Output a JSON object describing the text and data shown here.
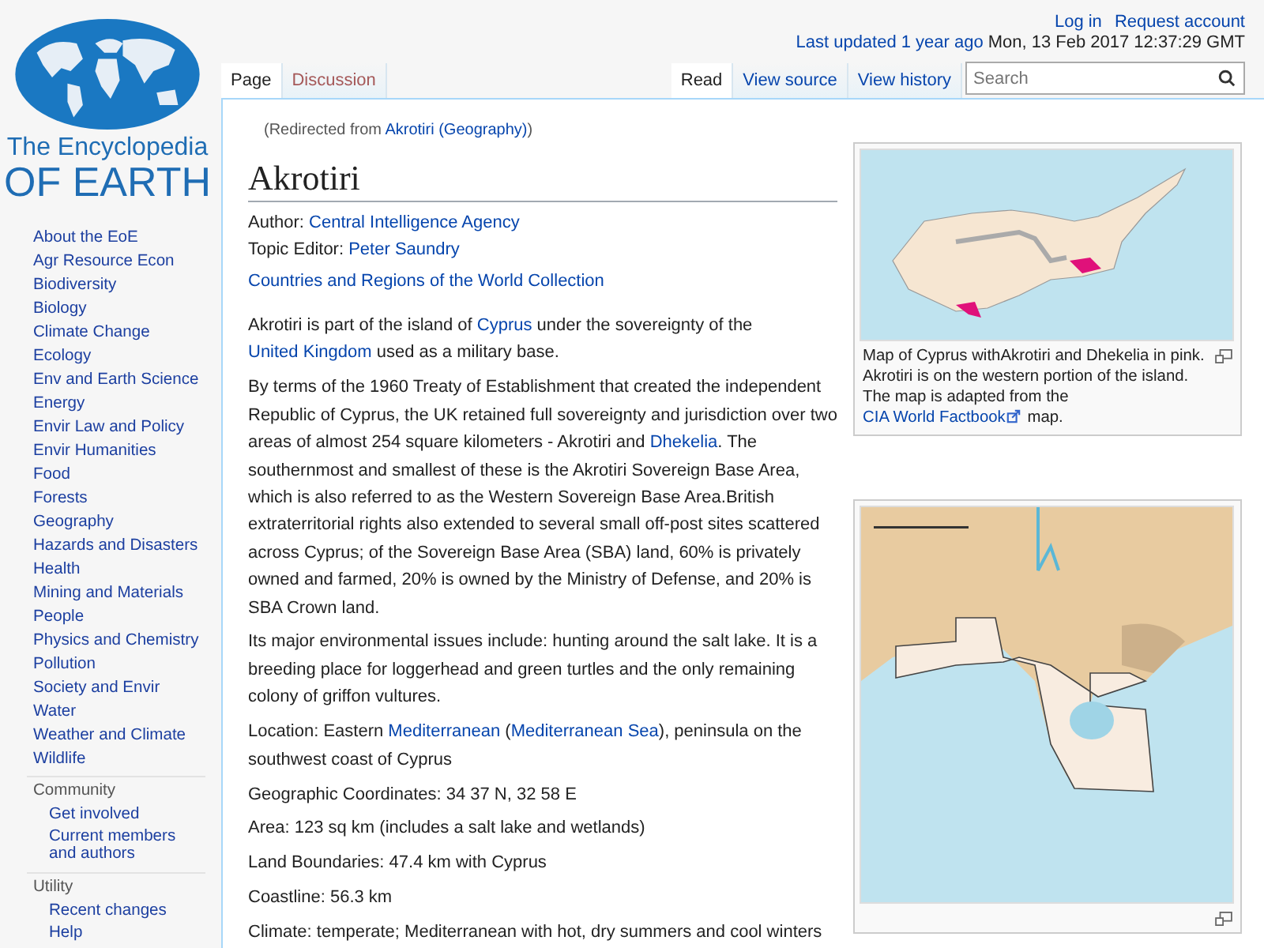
{
  "site_logo": {
    "line_1": "The Encyclopedia",
    "line_2": "OF EARTH"
  },
  "sidebar": {
    "portals": [
      "About the EoE",
      "Agr Resource Econ",
      "Biodiversity",
      "Biology",
      "Climate Change",
      "Ecology",
      "Env and Earth Science",
      "Energy",
      "Envir Law and Policy",
      "Envir Humanities",
      "Food",
      "Forests",
      "Geography",
      "Hazards and Disasters",
      "Health",
      "Mining and Materials",
      "People",
      "Physics and Chemistry",
      "Pollution",
      "Society and Envir",
      "Water",
      "Weather and Climate",
      "Wildlife"
    ],
    "sections": [
      {
        "heading": "Community",
        "items": [
          "Get involved",
          "Current members and authors"
        ]
      },
      {
        "heading": "Utility",
        "items": [
          "Recent changes",
          "Help"
        ]
      }
    ]
  },
  "personal_links": [
    "Log in",
    "Request account"
  ],
  "last_updated": {
    "label": "Last updated",
    "link": "1 year ago",
    "date": "Mon, 13 Feb 2017 12:37:29 GMT"
  },
  "namespace_tabs": [
    {
      "label": "Page",
      "selected": true,
      "missing": false
    },
    {
      "label": "Discussion",
      "selected": false,
      "missing": true
    }
  ],
  "view_tabs": [
    {
      "label": "Read",
      "selected": true
    },
    {
      "label": "View source",
      "selected": false
    },
    {
      "label": "View history",
      "selected": false
    }
  ],
  "search": {
    "placeholder": "Search"
  },
  "redirect": [
    {
      "kind": "text",
      "text": "(Redirected from "
    },
    {
      "kind": "link",
      "text": "Akrotiri (Geography)"
    },
    {
      "kind": "text",
      "text": ")"
    }
  ],
  "title": "Akrotiri",
  "meta": [
    {
      "label": "Author:",
      "value": "Central Intelligence Agency"
    },
    {
      "label": "Topic Editor:",
      "value": "Peter Saundry"
    }
  ],
  "collection_link": "Countries and Regions of the World Collection",
  "figures": [
    {
      "kind": "island_map",
      "caption": [
        {
          "kind": "text",
          "text": "Map of Cyprus withAkrotiri and Dhekelia in pink. Akrotiri is on the western portion of the island. The map is adapted from the "
        },
        {
          "kind": "external_link",
          "text": "CIA World Factbook"
        },
        {
          "kind": "text",
          "text": " map."
        }
      ]
    },
    {
      "kind": "area_map"
    }
  ],
  "paragraphs": [
    [
      {
        "kind": "text",
        "text": "Akrotiri is part of the island of "
      },
      {
        "kind": "link",
        "text": "Cyprus"
      },
      {
        "kind": "text",
        "text": " under the sovereignty of the "
      },
      {
        "kind": "link",
        "text": "United Kingdom"
      },
      {
        "kind": "text",
        "text": " used as a military base."
      }
    ],
    [
      {
        "kind": "text",
        "text": "By terms of the 1960 Treaty of Establishment that created the independent Republic of Cyprus, the UK retained full sovereignty and jurisdiction over two areas of almost 254 square kilometers - Akrotiri and "
      },
      {
        "kind": "link",
        "text": "Dhekelia"
      },
      {
        "kind": "text",
        "text": ". The southernmost and smallest of these is the Akrotiri Sovereign Base Area, which is also referred to as the Western Sovereign Base Area.British extraterritorial rights also extended to several small off-post sites scattered across Cyprus; of the Sovereign Base Area (SBA) land, 60% is privately owned and farmed, 20% is owned by the Ministry of Defense, and 20% is SBA Crown land."
      }
    ],
    [
      {
        "kind": "text",
        "text": "Its major environmental issues include: hunting around the salt lake. It is a breeding place for loggerhead and green turtles and the only remaining colony of griffon vultures."
      }
    ],
    [
      {
        "kind": "text",
        "text": "Location: Eastern "
      },
      {
        "kind": "link",
        "text": "Mediterranean"
      },
      {
        "kind": "text",
        "text": " ("
      },
      {
        "kind": "link",
        "text": "Mediterranean Sea"
      },
      {
        "kind": "text",
        "text": "), peninsula on the southwest coast of Cyprus"
      }
    ],
    [
      {
        "kind": "text",
        "text": "Geographic Coordinates: 34 37 N, 32 58 E"
      }
    ],
    [
      {
        "kind": "text",
        "text": "Area: 123 sq km (includes a salt lake and wetlands)"
      }
    ],
    [
      {
        "kind": "text",
        "text": "Land Boundaries: 47.4 km with Cyprus"
      }
    ],
    [
      {
        "kind": "text",
        "text": "Coastline: 56.3 km"
      }
    ],
    [
      {
        "kind": "text",
        "text": "Climate: temperate; Mediterranean with hot, dry summers and cool winters"
      }
    ]
  ]
}
